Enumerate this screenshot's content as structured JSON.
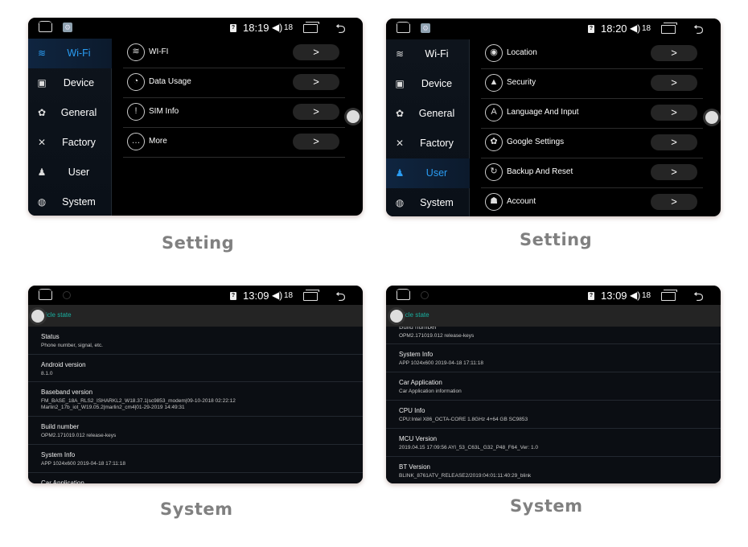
{
  "screens": {
    "s1": {
      "status": {
        "time": "18:19",
        "volume_icon": "◀)",
        "volume": "18",
        "back_icon": "⮌"
      },
      "sidebar": [
        {
          "label": "Wi-Fi",
          "icon": "wifi-icon",
          "glyph": "≋",
          "active": true
        },
        {
          "label": "Device",
          "icon": "device-icon",
          "glyph": "▣",
          "active": false
        },
        {
          "label": "General",
          "icon": "gear-icon",
          "glyph": "✿",
          "active": false
        },
        {
          "label": "Factory",
          "icon": "tools-icon",
          "glyph": "✕",
          "active": false
        },
        {
          "label": "User",
          "icon": "user-icon",
          "glyph": "♟",
          "active": false
        },
        {
          "label": "System",
          "icon": "globe-icon",
          "glyph": "◍",
          "active": false
        }
      ],
      "menu": [
        {
          "label": "WI-FI",
          "glyph": "≋"
        },
        {
          "label": "Data Usage",
          "glyph": "◔"
        },
        {
          "label": "SIM Info",
          "glyph": "!"
        },
        {
          "label": "More",
          "glyph": "…"
        }
      ],
      "arrow": ">"
    },
    "s2": {
      "status": {
        "time": "18:20",
        "volume_icon": "◀)",
        "volume": "18",
        "back_icon": "⮌"
      },
      "sidebar": [
        {
          "label": "Wi-Fi",
          "glyph": "≋"
        },
        {
          "label": "Device",
          "glyph": "▣"
        },
        {
          "label": "General",
          "glyph": "✿"
        },
        {
          "label": "Factory",
          "glyph": "✕"
        },
        {
          "label": "User",
          "glyph": "♟"
        },
        {
          "label": "System",
          "glyph": "◍"
        }
      ],
      "menu": [
        {
          "label": "Location",
          "glyph": "◉"
        },
        {
          "label": "Security",
          "glyph": "▲"
        },
        {
          "label": "Language And Input",
          "glyph": "A"
        },
        {
          "label": "Google Settings",
          "glyph": "✿"
        },
        {
          "label": "Backup And Reset",
          "glyph": "↻"
        },
        {
          "label": "Account",
          "glyph": "☗"
        }
      ],
      "arrow": ">"
    },
    "s3": {
      "status": {
        "time": "13:09",
        "volume_icon": "◀)",
        "volume": "18",
        "back_icon": "⮌"
      },
      "header": "icle state",
      "rows": [
        {
          "title": "Status",
          "lines": [
            "Phone number, signal, etc."
          ]
        },
        {
          "title": "Android version",
          "lines": [
            "8.1.0"
          ]
        },
        {
          "title": "Baseband version",
          "lines": [
            "FM_BASE_18A_RLS2_ISHARKL2_W18.37.1|sc9853_modem|09-10-2018 02:22:12",
            "Marlin2_17b_iot_W19.05.2|marlin2_cm4|01-29-2019 14:49:31"
          ]
        },
        {
          "title": "Build number",
          "lines": [
            "OPM2.171019.012 release-keys"
          ]
        },
        {
          "title": "System Info",
          "lines": [
            "APP 1024x600 2019-04-18 17:11:18"
          ]
        },
        {
          "title": "Car Application",
          "lines": []
        }
      ]
    },
    "s4": {
      "status": {
        "time": "13:09",
        "volume_icon": "◀)",
        "volume": "18",
        "back_icon": "⮌"
      },
      "header": "icle state",
      "rows": [
        {
          "title": "Build number",
          "lines": [
            "OPM2.171019.012 release-keys"
          ]
        },
        {
          "title": "System Info",
          "lines": [
            "APP 1024x600 2019-04-18 17:11:18"
          ]
        },
        {
          "title": "Car Application",
          "lines": [
            "Car Application information"
          ]
        },
        {
          "title": "CPU Info",
          "lines": [
            "CPU:Intel X86_OCTA-CORE 1.8GHz 4+64 GB SC9853"
          ]
        },
        {
          "title": "MCU Version",
          "lines": [
            "2019.04.15 17:09:56 AYI_53_C63L_G32_P48_F64_Ver: 1.0"
          ]
        },
        {
          "title": "BT Version",
          "lines": [
            "BLINK_8761ATV_RELEASE2/2019:04:01:11:40:29_blink"
          ]
        }
      ]
    }
  },
  "captions": [
    "Setting",
    "Setting",
    "System",
    "System"
  ],
  "colors": {
    "accent": "#2a9df4",
    "teal": "#19b0a0",
    "caption": "#808080"
  }
}
